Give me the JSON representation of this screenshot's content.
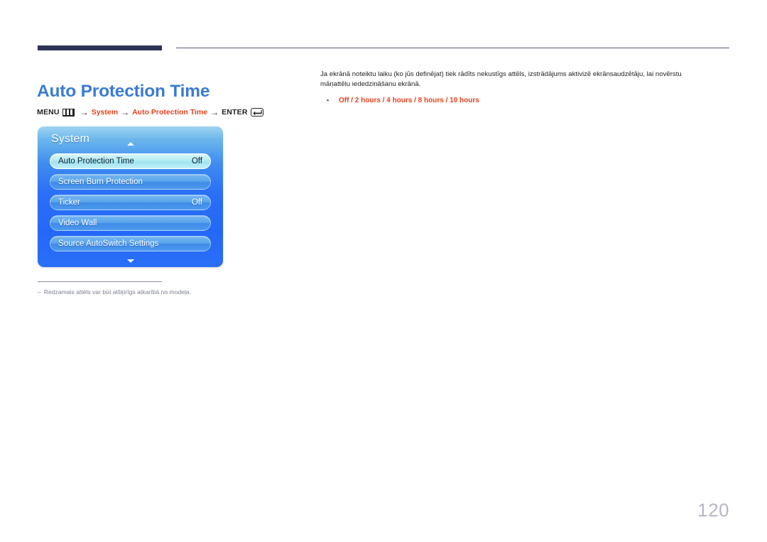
{
  "document": {
    "page_number": "120",
    "title": "Auto Protection Time",
    "title_color": "#3a7bd5",
    "accent_color": "#e8401c",
    "rule_color": "#2e3357"
  },
  "breadcrumb": {
    "menu_label": "MENU",
    "menu_icon": "menu-grid-icon",
    "arrow": "→",
    "step1": "System",
    "step2": "Auto Protection Time",
    "enter_label": "ENTER",
    "enter_icon": "enter-return-icon"
  },
  "osd": {
    "title": "System",
    "scroll_up_icon": "chevron-up-icon",
    "scroll_down_icon": "chevron-down-icon",
    "items": [
      {
        "label": "Auto Protection Time",
        "value": "Off",
        "selected": true
      },
      {
        "label": "Screen Burn Protection",
        "value": "",
        "selected": false
      },
      {
        "label": "Ticker",
        "value": "Off",
        "selected": false
      },
      {
        "label": "Video Wall",
        "value": "",
        "selected": false
      },
      {
        "label": "Source AutoSwitch Settings",
        "value": "",
        "selected": false
      }
    ]
  },
  "footnote": {
    "dash": "–",
    "text": "Redzamais attēls var būt atšķirīgs atkarībā no modeļa."
  },
  "body": {
    "paragraph": "Ja ekrānā noteiktu laiku (ko jūs definējat) tiek rādīts nekustīgs attēls, izstrādājums aktivizē ekrānsaudzētāju, lai novērstu māņattēlu iededzināšanu ekrānā.",
    "options": "Off / 2 hours / 4 hours / 8 hours / 10 hours"
  }
}
